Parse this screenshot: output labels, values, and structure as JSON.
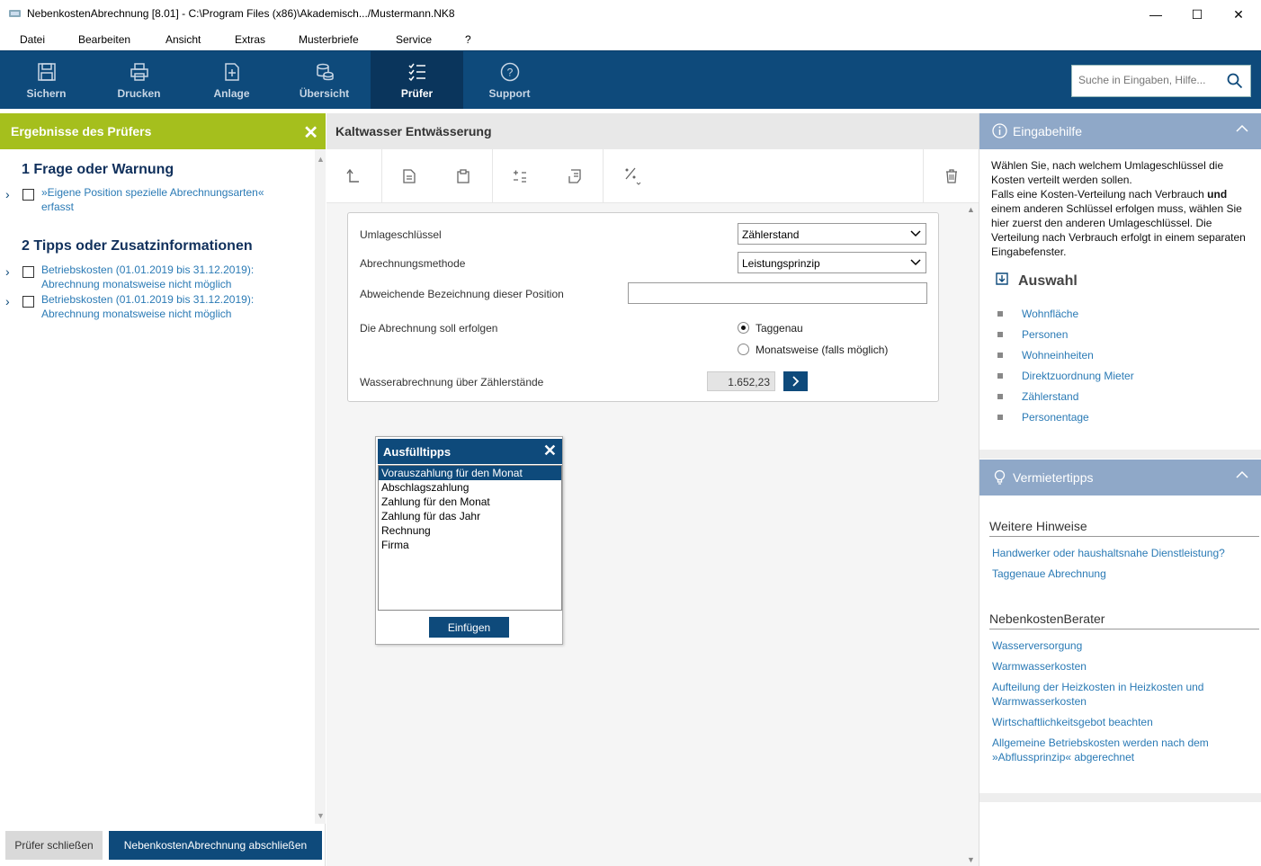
{
  "window": {
    "title": "NebenkostenAbrechnung [8.01] - C:\\Program Files (x86)\\Akademisch.../Mustermann.NK8",
    "minimize": "—",
    "maximize": "☐",
    "close": "✕"
  },
  "menu": [
    "Datei",
    "Bearbeiten",
    "Ansicht",
    "Extras",
    "Musterbriefe",
    "Service",
    "?"
  ],
  "toolbar": {
    "buttons": [
      {
        "label": "Sichern",
        "icon": "save-icon"
      },
      {
        "label": "Drucken",
        "icon": "printer-icon"
      },
      {
        "label": "Anlage",
        "icon": "attachment-icon"
      },
      {
        "label": "Übersicht",
        "icon": "coins-icon"
      },
      {
        "label": "Prüfer",
        "icon": "checklist-icon",
        "active": true
      },
      {
        "label": "Support",
        "icon": "help-icon"
      }
    ],
    "search_placeholder": "Suche in Eingaben, Hilfe..."
  },
  "left": {
    "header": "Ergebnisse des Prüfers",
    "section1": "1 Frage oder Warnung",
    "warnings": [
      {
        "line1": "»Eigene Position spezielle Abrechnungsarten«",
        "line2": "erfasst"
      }
    ],
    "section2": "2 Tipps oder Zusatzinformationen",
    "tips": [
      {
        "line1": "Betriebskosten (01.01.2019 bis 31.12.2019):",
        "line2": "Abrechnung monatsweise nicht möglich"
      },
      {
        "line1": "Betriebskosten (01.01.2019 bis 31.12.2019):",
        "line2": "Abrechnung monatsweise nicht möglich"
      }
    ],
    "btn_close": "Prüfer schließen",
    "btn_finish": "NebenkostenAbrechnung abschließen"
  },
  "center": {
    "title": "Kaltwasser Entwässerung",
    "form": {
      "umlage_label": "Umlageschlüssel",
      "umlage_value": "Zählerstand",
      "methode_label": "Abrechnungsmethode",
      "methode_value": "Leistungsprinzip",
      "bezeichnung_label": "Abweichende Bezeichnung dieser Position",
      "bezeichnung_value": "",
      "abrechnung_label": "Die Abrechnung soll erfolgen",
      "radio_taggenau": "Taggenau",
      "radio_monatsweise": "Monatsweise (falls möglich)",
      "wasser_label": "Wasserabrechnung über Zählerstände",
      "wasser_value": "1.652,23"
    },
    "popup": {
      "title": "Ausfülltipps",
      "options": [
        "Vorauszahlung für den Monat",
        "Abschlagszahlung",
        "Zahlung für den Monat",
        "Zahlung für das Jahr",
        "Rechnung",
        "Firma"
      ],
      "button": "Einfügen"
    }
  },
  "right": {
    "eingabehilfe_title": "Eingabehilfe",
    "eingabehilfe_text_1": "Wählen Sie, nach welchem Umlageschlüssel die Kosten verteilt werden sollen.",
    "eingabehilfe_text_2a": "Falls eine Kosten-Verteilung nach Verbrauch ",
    "eingabehilfe_text_2b": "und",
    "eingabehilfe_text_2c": " einem anderen Schlüssel erfolgen muss, wählen Sie hier zuerst den anderen Umlageschlüssel. Die Verteilung nach Verbrauch erfolgt in einem separaten Eingabefenster.",
    "auswahl_title": "Auswahl",
    "auswahl": [
      "Wohnfläche",
      "Personen",
      "Wohneinheiten",
      "Direktzuordnung Mieter",
      "Zählerstand",
      "Personentage"
    ],
    "vermieter_title": "Vermietertipps",
    "weitere_title": "Weitere Hinweise",
    "weitere": [
      "Handwerker oder haushaltsnahe Dienstleistung?",
      "Taggenaue Abrechnung"
    ],
    "berater_title": "NebenkostenBerater",
    "berater": [
      "Wasserversorgung",
      "Warmwasserkosten",
      "Aufteilung der Heizkosten in Heizkosten und Warmwasserkosten",
      "Wirtschaftlichkeitsgebot beachten",
      "Allgemeine Betriebskosten werden nach dem »Abflussprinzip« abgerechnet"
    ]
  }
}
